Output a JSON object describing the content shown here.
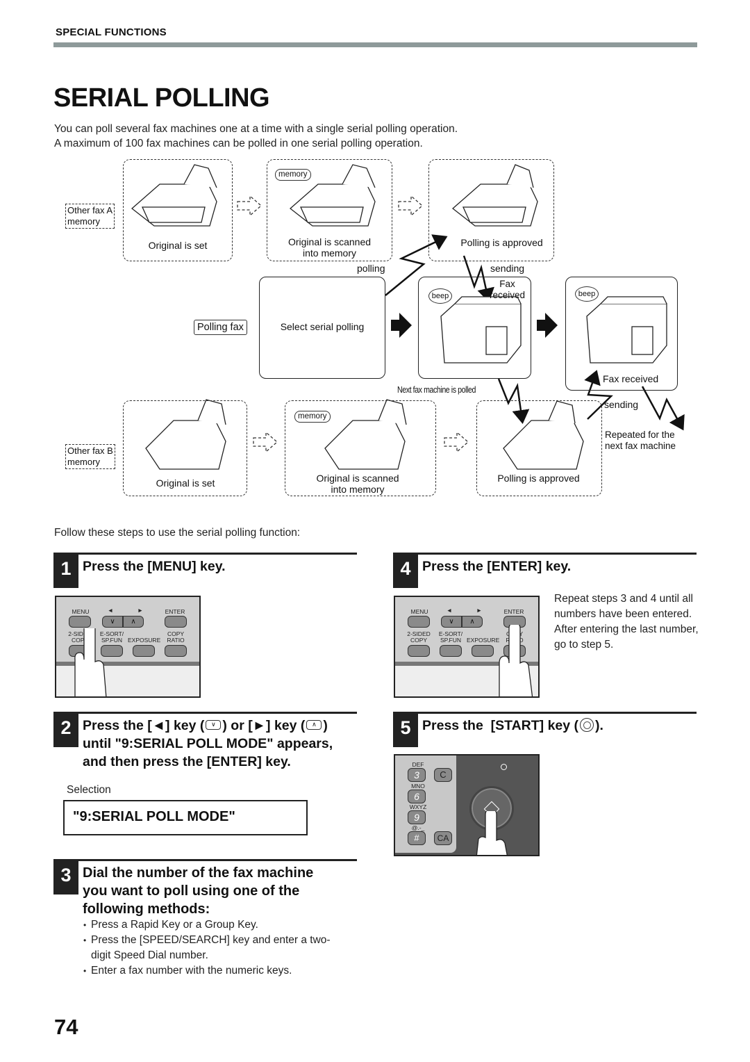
{
  "header": {
    "section": "SPECIAL FUNCTIONS",
    "title": "SERIAL POLLING",
    "intro_lines": [
      "You can poll several fax machines one at a time with a single serial polling operation.",
      "A maximum of 100 fax machines can be polled in one serial polling operation."
    ]
  },
  "diagram": {
    "fax_a_label": [
      "Other fax A",
      "memory"
    ],
    "fax_b_label": [
      "Other fax B",
      "memory"
    ],
    "original_set": "Original is set",
    "scanned": [
      "Original is scanned",
      "into memory"
    ],
    "memory_pill": "memory",
    "polling_approved": "Polling is approved",
    "polling": "polling",
    "sending": "sending",
    "fax_received_top": [
      "Fax",
      "received"
    ],
    "polling_fax_key": "Polling fax",
    "select_serial": "Select serial polling",
    "beep": "beep",
    "next_polled": "Next fax machine is polled",
    "fax_received": "Fax received",
    "repeated": [
      "Repeated for the",
      "next fax machine"
    ]
  },
  "follow_text": "Follow these steps to use the serial polling function:",
  "steps": [
    {
      "num": "1",
      "title": "Press the [MENU] key."
    },
    {
      "num": "2",
      "title_parts": [
        "Press the [",
        "◄",
        "] key (",
        ") or [",
        "►",
        "] key (",
        ")"
      ],
      "title_line2": "until \"9:SERIAL POLL MODE\" appears,",
      "title_line3": "and then press the [ENTER] key.",
      "selection_label": "Selection",
      "selection_value": "\"9:SERIAL POLL MODE\""
    },
    {
      "num": "3",
      "title_lines": [
        "Dial the number of the fax machine",
        "you want to poll using one of the",
        "following methods:"
      ],
      "bullets": [
        "Press a Rapid Key or a Group Key.",
        "Press the [SPEED/SEARCH] key and enter a two-digit Speed Dial number.",
        "Enter a fax number with the numeric keys."
      ]
    },
    {
      "num": "4",
      "title": "Press the [ENTER] key.",
      "note": "Repeat steps 3 and 4 until all numbers have been entered. After entering the last number, go to step 5."
    },
    {
      "num": "5",
      "title_pre": "Press the  [START] key (",
      "title_post": ")."
    }
  ],
  "panel_keys": {
    "menu": "MENU",
    "left": "◄",
    "right": "►",
    "enter": "ENTER",
    "down": "∨",
    "up": "∧",
    "two_sided": [
      "2-SIDED",
      "COPY"
    ],
    "esort": [
      "E-SORT/",
      "SP.FUN"
    ],
    "exposure": "EXPOSURE",
    "copy_ratio": [
      "COPY",
      "RATIO"
    ]
  },
  "keypad": {
    "keys": [
      {
        "sub": "DEF",
        "label": "3"
      },
      {
        "sub": "MNO",
        "label": "6"
      },
      {
        "sub": "WXYZ",
        "label": "9"
      },
      {
        "sub": "@.-_",
        "label": "#"
      }
    ],
    "c": "C",
    "ca": "CA"
  },
  "page_number": "74"
}
